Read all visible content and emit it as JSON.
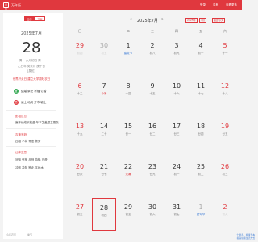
{
  "app": {
    "logo": "日历",
    "title": "万年历"
  },
  "topnav": [
    "登录",
    "注册",
    "查看更多"
  ],
  "left": {
    "toggle": [
      "日历",
      "节假"
    ],
    "year_month": "2025年7月",
    "day": "28",
    "weekday_line": "周一 六月初四 周一",
    "ganzhi_line": "乙巳年 癸未月 庚午日",
    "extra_line": "[属蛇]",
    "festival_line": "世界肝炎日 建立大学翻吐农日",
    "row1_label": "宜",
    "row1_text": "结婚 祭祀 祈福 订婚",
    "row2_label": "忌",
    "row2_text": "诸土 动刷 开市 敏土",
    "sections": [
      {
        "t": "彭祖百忌",
        "red": true
      },
      {
        "t": "庚不经络织机虚 午不苫盖屋主更张",
        "red": false
      },
      {
        "t": "吉神宜趋",
        "red": true
      },
      {
        "t": "四相 不将 青龙 敬安",
        "red": false
      },
      {
        "t": "凶神宜忌",
        "red": true
      },
      {
        "t": "河魁 死神 月刑 游祸 五虚",
        "red": false
      },
      {
        "t": "冲煞 冲鼠 煞北 平地木",
        "red": false
      }
    ],
    "footer": [
      "今年农历",
      "季节"
    ]
  },
  "controls": {
    "prev": "<",
    "month": "2025年7月",
    "next": ">",
    "select1": "2025年",
    "select2": "7月",
    "select3": "返回今天"
  },
  "weekdays": [
    "日",
    "一",
    "二",
    "三",
    "四",
    "五",
    "六"
  ],
  "weeks": [
    [
      [
        "29",
        "初四",
        "dim"
      ],
      [
        "30",
        "初五",
        "dim"
      ],
      [
        "1",
        "建党节",
        "blue"
      ],
      [
        "2",
        "初八",
        ""
      ],
      [
        "3",
        "初九",
        ""
      ],
      [
        "4",
        "初十",
        ""
      ],
      [
        "5",
        "十一",
        "wkend"
      ]
    ],
    [
      [
        "6",
        "十二",
        "wkend"
      ],
      [
        "7",
        "小暑",
        "red"
      ],
      [
        "8",
        "十四",
        ""
      ],
      [
        "9",
        "十五",
        ""
      ],
      [
        "10",
        "十六",
        ""
      ],
      [
        "11",
        "十七",
        ""
      ],
      [
        "12",
        "十八",
        "wkend"
      ]
    ],
    [
      [
        "13",
        "十九",
        "wkend"
      ],
      [
        "14",
        "二十",
        ""
      ],
      [
        "15",
        "廿一",
        ""
      ],
      [
        "16",
        "廿二",
        ""
      ],
      [
        "17",
        "廿三",
        ""
      ],
      [
        "18",
        "廿四",
        ""
      ],
      [
        "19",
        "廿五",
        "wkend"
      ]
    ],
    [
      [
        "20",
        "廿六",
        "wkend"
      ],
      [
        "21",
        "廿七",
        ""
      ],
      [
        "22",
        "大暑",
        "red"
      ],
      [
        "23",
        "廿九",
        ""
      ],
      [
        "24",
        "初一",
        ""
      ],
      [
        "25",
        "初二",
        ""
      ],
      [
        "26",
        "初三",
        "wkend"
      ]
    ],
    [
      [
        "27",
        "初三",
        "wkend"
      ],
      [
        "28",
        "初四",
        "today"
      ],
      [
        "29",
        "初五",
        ""
      ],
      [
        "30",
        "初六",
        ""
      ],
      [
        "31",
        "初七",
        ""
      ],
      [
        "1",
        "建军节",
        "dim blue"
      ],
      [
        "2",
        "初九",
        "dim"
      ]
    ]
  ],
  "bottom": [
    "仁者寿，健康为本",
    "提倡健康生活方式"
  ]
}
